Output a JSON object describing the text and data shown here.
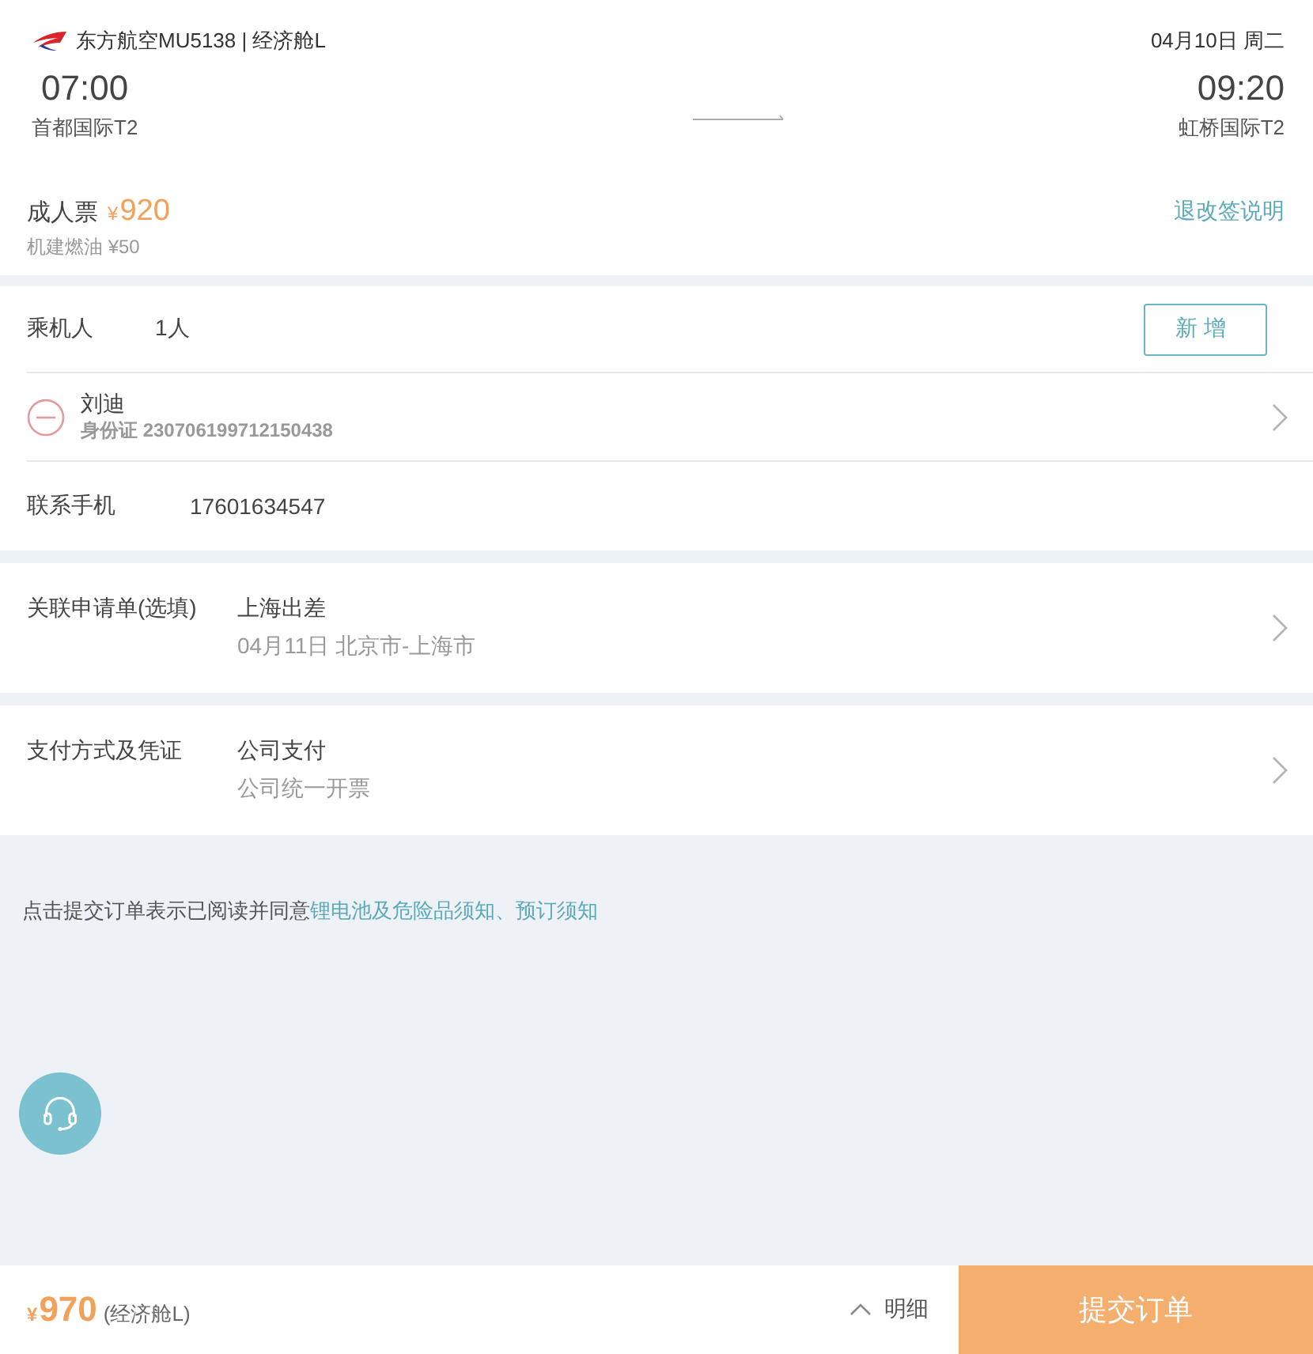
{
  "flight": {
    "airline": "东方航空MU5138 | 经济舱L",
    "date": "04月10日 周二",
    "departure": {
      "time": "07:00",
      "airport": "首都国际T2"
    },
    "arrival": {
      "time": "09:20",
      "airport": "虹桥国际T2"
    }
  },
  "fare": {
    "label": "成人票",
    "currency": "¥",
    "price": "920",
    "tax": "机建燃油 ¥50",
    "policy_link": "退改签说明"
  },
  "passengers": {
    "label": "乘机人",
    "count": "1人",
    "add_button": "新增",
    "list": [
      {
        "name": "刘迪",
        "id": "身份证 230706199712150438"
      }
    ]
  },
  "contact": {
    "label": "联系手机",
    "phone": "17601634547"
  },
  "sections": [
    {
      "label": "关联申请单(选填)",
      "title": "上海出差",
      "detail": "04月11日 北京市-上海市"
    },
    {
      "label": "支付方式及凭证",
      "title": "公司支付",
      "detail": "公司统一开票"
    }
  ],
  "agreement": {
    "text": "点击提交订单表示已阅读并同意",
    "links": [
      "锂电池及危险品须知",
      "预订须知"
    ],
    "separator": "、"
  },
  "bottom_bar": {
    "currency": "¥",
    "total": "970",
    "cabin": "(经济舱L)",
    "details": "明细",
    "submit": "提交订单"
  }
}
